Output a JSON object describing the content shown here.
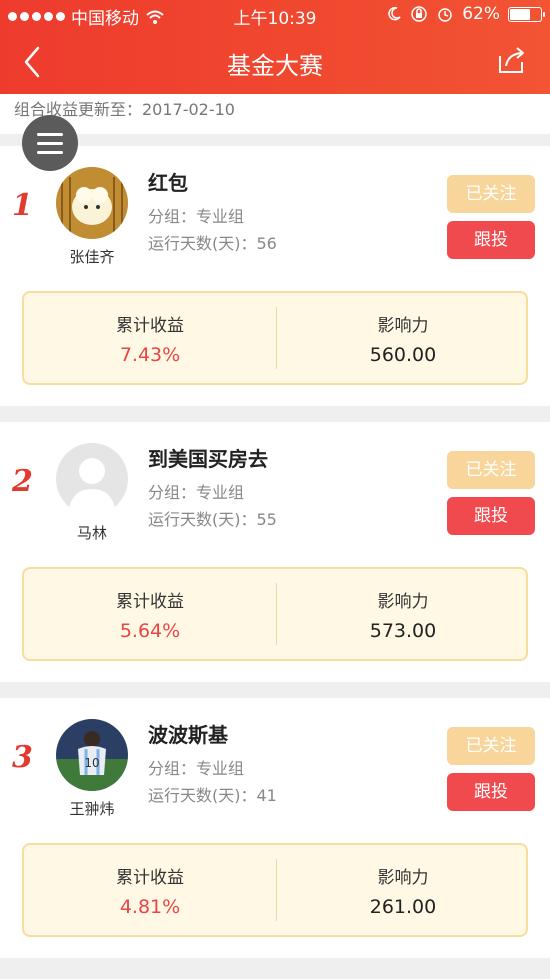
{
  "status_bar": {
    "carrier": "中国移动",
    "time": "上午10:39",
    "battery": "62%",
    "battery_level": 0.62
  },
  "nav": {
    "title": "基金大赛",
    "back_icon": "chevron-left-icon",
    "share_icon": "share-icon"
  },
  "update": {
    "text": "组合收益更新至：2017-02-10"
  },
  "menu": {
    "icon": "hamburger-menu-icon"
  },
  "entries": [
    {
      "rank": "1",
      "user": "张佳齐",
      "portfolio": "红包",
      "group": "分组：专业组",
      "days": "运行天数(天)：56",
      "follow_label": "已关注",
      "invest_label": "跟投",
      "return_label": "累计收益",
      "return_value": "7.43%",
      "influence_label": "影响力",
      "influence_value": "560.00"
    },
    {
      "rank": "2",
      "user": "马林",
      "portfolio": "到美国买房去",
      "group": "分组：专业组",
      "days": "运行天数(天)：55",
      "follow_label": "已关注",
      "invest_label": "跟投",
      "return_label": "累计收益",
      "return_value": "5.64%",
      "influence_label": "影响力",
      "influence_value": "573.00"
    },
    {
      "rank": "3",
      "user": "王翀炜",
      "portfolio": "波波斯基",
      "group": "分组：专业组",
      "days": "运行天数(天)：41",
      "follow_label": "已关注",
      "invest_label": "跟投",
      "return_label": "累计收益",
      "return_value": "4.81%",
      "influence_label": "影响力",
      "influence_value": "261.00"
    }
  ],
  "colors": {
    "brand_red": "#ee3b2e",
    "follow_bg": "#f8d59a",
    "invest_bg": "#f04a4f",
    "return_red": "#e84545",
    "stats_bg": "#fff8e5"
  }
}
